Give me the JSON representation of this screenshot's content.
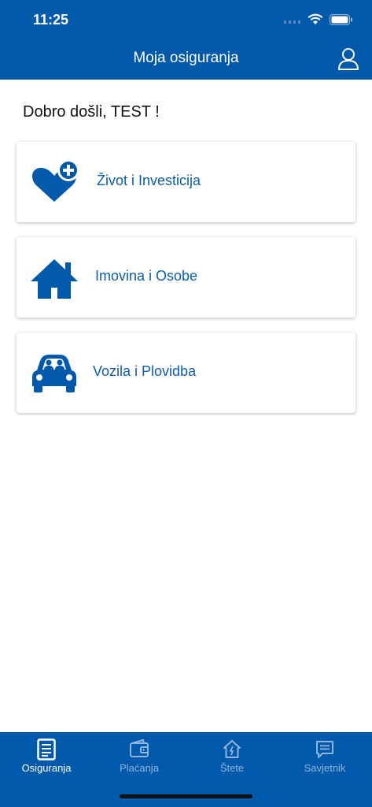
{
  "status_bar": {
    "time": "11:25"
  },
  "header": {
    "title": "Moja osiguranja",
    "profile_icon": "user-icon"
  },
  "greeting": "Dobro došli, TEST !",
  "categories": [
    {
      "label": "Život i Investicija",
      "icon": "heart-plus-icon"
    },
    {
      "label": "Imovina i Osobe",
      "icon": "house-icon"
    },
    {
      "label": "Vozila i Plovidba",
      "icon": "car-icon"
    }
  ],
  "tabs": [
    {
      "label": "Osiguranja",
      "icon": "document-icon",
      "active": true
    },
    {
      "label": "Plaćanja",
      "icon": "wallet-icon",
      "active": false
    },
    {
      "label": "Štete",
      "icon": "house-claim-icon",
      "active": false
    },
    {
      "label": "Savjetnik",
      "icon": "chat-icon",
      "active": false
    }
  ],
  "colors": {
    "primary": "#0059aa",
    "accent_text": "#0d5da9",
    "inactive_tab": "#8fb4de"
  }
}
